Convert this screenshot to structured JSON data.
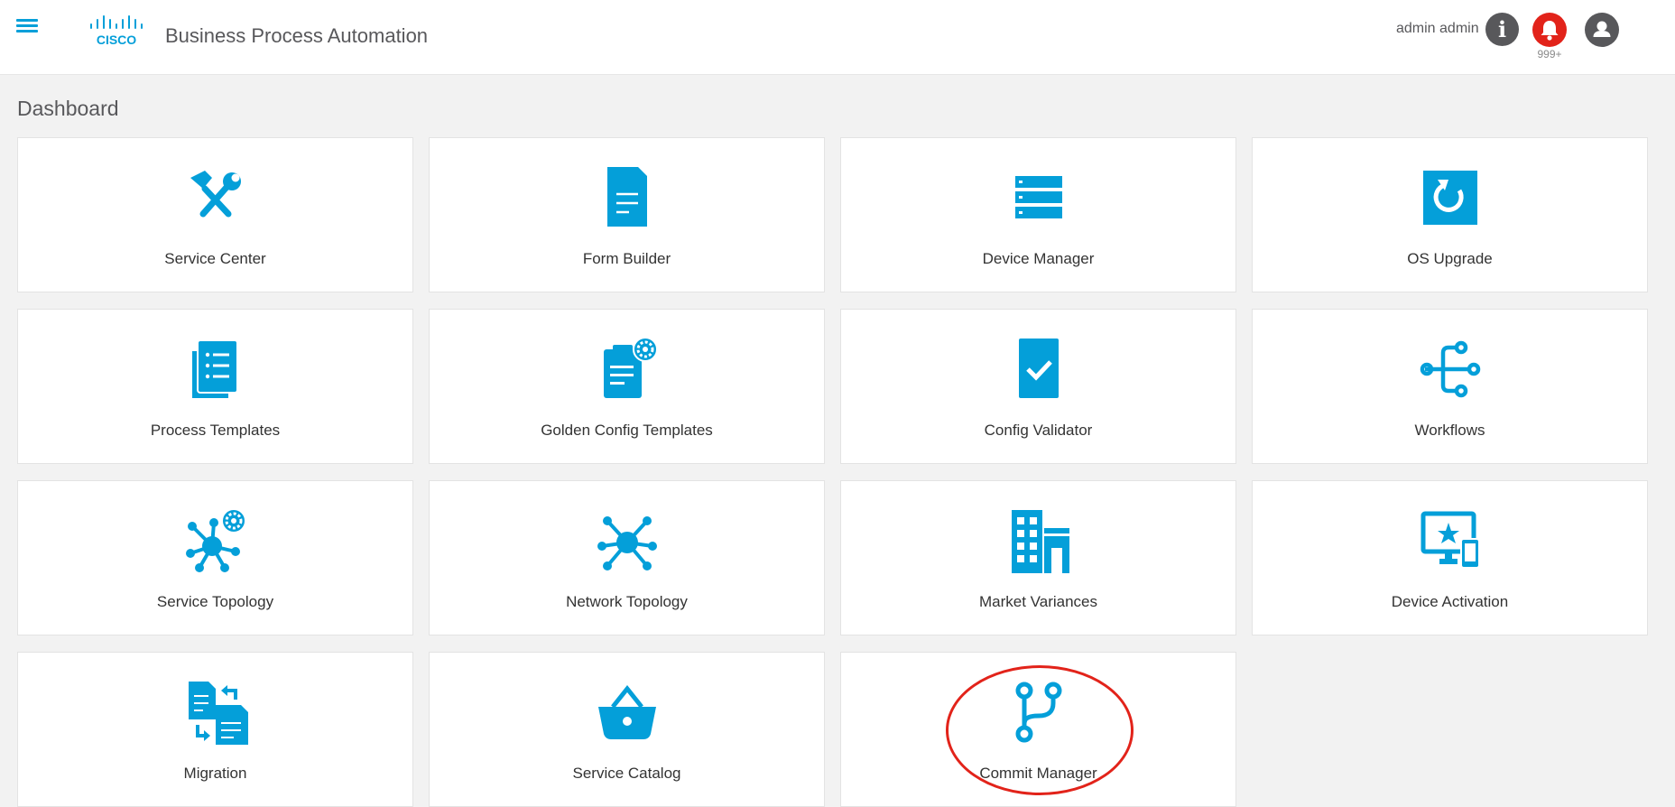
{
  "header": {
    "menu_icon": "hamburger-menu-icon",
    "logo_text": "CISCO",
    "app_title": "Business Process Automation",
    "user_name": "admin admin",
    "info_icon": "info-icon",
    "bell_icon": "bell-icon",
    "notification_count": "999+",
    "profile_icon": "user-icon"
  },
  "colors": {
    "accent": "#049fd9",
    "notification": "#e2231a",
    "header_icon": "#58585b",
    "background": "#f2f2f2"
  },
  "dashboard": {
    "title": "Dashboard",
    "tiles": [
      {
        "label": "Service Center",
        "icon": "tools-icon"
      },
      {
        "label": "Form Builder",
        "icon": "document-icon"
      },
      {
        "label": "Device Manager",
        "icon": "server-icon"
      },
      {
        "label": "OS Upgrade",
        "icon": "refresh-icon"
      },
      {
        "label": "Process Templates",
        "icon": "list-document-icon"
      },
      {
        "label": "Golden Config Templates",
        "icon": "clipboard-gear-icon"
      },
      {
        "label": "Config Validator",
        "icon": "check-document-icon"
      },
      {
        "label": "Workflows",
        "icon": "workflow-icon"
      },
      {
        "label": "Service Topology",
        "icon": "topology-gear-icon"
      },
      {
        "label": "Network Topology",
        "icon": "network-icon"
      },
      {
        "label": "Market Variances",
        "icon": "buildings-icon"
      },
      {
        "label": "Device Activation",
        "icon": "monitor-devices-icon"
      },
      {
        "label": "Migration",
        "icon": "swap-documents-icon"
      },
      {
        "label": "Service Catalog",
        "icon": "basket-icon"
      },
      {
        "label": "Commit Manager",
        "icon": "git-branch-icon"
      }
    ]
  }
}
